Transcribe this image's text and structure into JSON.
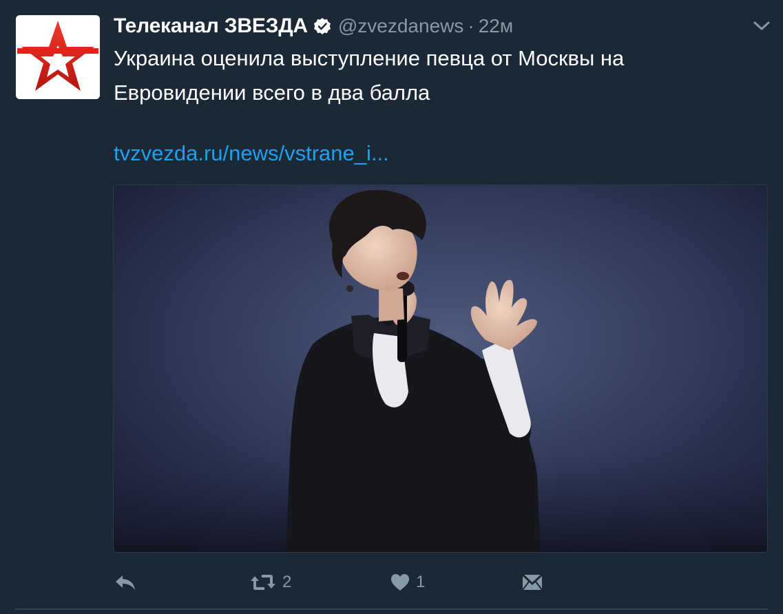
{
  "tweet": {
    "display_name": "Телеканал ЗВЕЗДА",
    "handle": "@zvezdanews",
    "separator": "·",
    "time": "22м",
    "text": "Украина оценила выступление певца от Москвы на Евровидении всего в два балла",
    "link": "tvzvezda.ru/news/vstrane_i..."
  },
  "icons": {
    "avatar": "red-star-logo",
    "verified": "verified-badge-icon",
    "more": "chevron-down-icon",
    "reply": "reply-icon",
    "retweet": "retweet-icon",
    "like": "heart-icon",
    "dm": "direct-message-icon"
  },
  "actions": {
    "retweet_count": "2",
    "like_count": "1"
  },
  "colors": {
    "background": "#1b2836",
    "text": "#ffffff",
    "muted": "#8899a6",
    "link": "#1da1f2",
    "logo_red": "#e2231a"
  }
}
